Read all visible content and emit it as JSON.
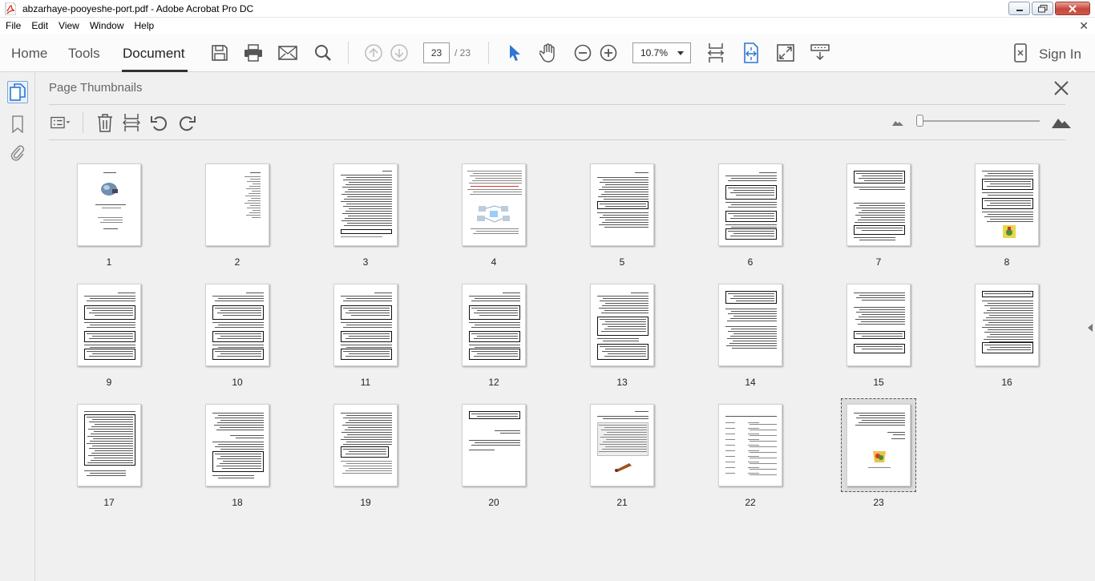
{
  "window": {
    "title": "abzarhaye-pooyeshe-port.pdf - Adobe Acrobat Pro DC"
  },
  "menu": [
    "File",
    "Edit",
    "View",
    "Window",
    "Help"
  ],
  "toolbar": {
    "tabs": [
      "Home",
      "Tools",
      "Document"
    ],
    "active_tab": "Document",
    "current_page": "23",
    "page_total": "/ 23",
    "zoom": "10.7%",
    "sign_in": "Sign In"
  },
  "panel": {
    "title": "Page Thumbnails"
  },
  "thumbnails": [
    {
      "label": "1",
      "kind": "cover"
    },
    {
      "label": "2",
      "kind": "toc"
    },
    {
      "label": "3",
      "kind": "text-box-bottom"
    },
    {
      "label": "4",
      "kind": "diagram"
    },
    {
      "label": "5",
      "kind": "text-box-mid"
    },
    {
      "label": "6",
      "kind": "boxes"
    },
    {
      "label": "7",
      "kind": "boxes-top-bottom"
    },
    {
      "label": "8",
      "kind": "boxes-image"
    },
    {
      "label": "9",
      "kind": "boxes"
    },
    {
      "label": "10",
      "kind": "boxes"
    },
    {
      "label": "11",
      "kind": "boxes"
    },
    {
      "label": "12",
      "kind": "boxes"
    },
    {
      "label": "13",
      "kind": "text-box-large"
    },
    {
      "label": "14",
      "kind": "text-box-top"
    },
    {
      "label": "15",
      "kind": "text-box-bottom2"
    },
    {
      "label": "16",
      "kind": "text-box-top2"
    },
    {
      "label": "17",
      "kind": "box-large"
    },
    {
      "label": "18",
      "kind": "table-box"
    },
    {
      "label": "19",
      "kind": "text-box-mid2"
    },
    {
      "label": "20",
      "kind": "sparse"
    },
    {
      "label": "21",
      "kind": "table-image"
    },
    {
      "label": "22",
      "kind": "table"
    },
    {
      "label": "23",
      "kind": "ending",
      "selected": true
    }
  ],
  "colors": {
    "accent_blue": "#2d77d3",
    "close_red": "#c7463a"
  },
  "icons": {
    "save": "save-icon",
    "print": "print-icon",
    "email": "mail-icon",
    "search": "search-icon"
  }
}
